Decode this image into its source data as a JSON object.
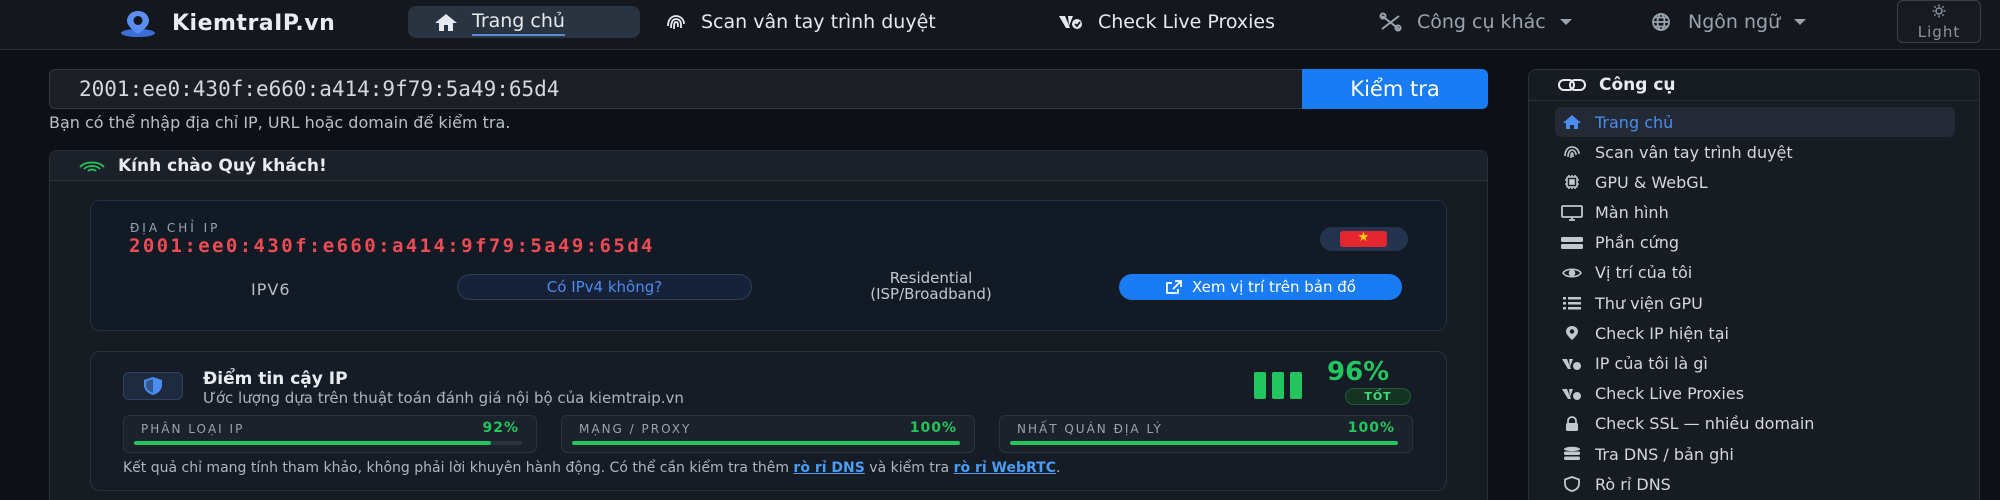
{
  "nav": {
    "brand": "KiemtraIP.vn",
    "items": [
      {
        "label": "Trang chủ",
        "icon": "home-icon",
        "active": true
      },
      {
        "label": "Scan vân tay trình duyệt",
        "icon": "fingerprint-icon"
      },
      {
        "label": "Check Live Proxies",
        "icon": "proxy-icon"
      },
      {
        "label": "Công cụ khác",
        "icon": "tools-icon",
        "dropdown": true
      },
      {
        "label": "Ngôn ngữ",
        "icon": "globe-icon",
        "dropdown": true
      }
    ],
    "theme_label": "Light"
  },
  "search": {
    "value": "2001:ee0:430f:e660:a414:9f79:5a49:65d4",
    "button": "Kiểm tra",
    "hint": "Bạn có thể nhập địa chỉ IP, URL hoặc domain để kiểm tra."
  },
  "welcome": {
    "title": "Kính chào Quý khách!",
    "ip_caption": "ĐỊA CHỈ IP",
    "ip": "2001:ee0:430f:e660:a414:9f79:5a49:65d4",
    "country_flag": "vietnam-flag",
    "ip_version": "IPV6",
    "ipv4_button": "Có IPv4 không?",
    "connection_line1": "Residential",
    "connection_line2": "(ISP/Broadband)",
    "map_button": "Xem vị trí trên bản đồ"
  },
  "trust": {
    "title": "Điểm tin cậy IP",
    "subtitle": "Ước lượng dựa trên thuật toán đánh giá nội bộ của kiemtraip.vn",
    "score": "96%",
    "label": "TỐT",
    "metrics": [
      {
        "label": "PHÂN LOẠI IP",
        "value": "92%",
        "fraction": 0.92
      },
      {
        "label": "MẠNG / PROXY",
        "value": "100%",
        "fraction": 1.0
      },
      {
        "label": "NHẤT QUÁN ĐỊA LÝ",
        "value": "100%",
        "fraction": 1.0
      }
    ],
    "note_prefix": "Kết quả chỉ mang tính tham khảo, không phải lời khuyên hành động. Có thể cần kiểm tra thêm ",
    "note_link1": "rò rỉ DNS",
    "note_mid": " và kiểm tra ",
    "note_link2": "rò rỉ WebRTC",
    "note_suffix": "."
  },
  "sidebar": {
    "title": "Công cụ",
    "items": [
      {
        "label": "Trang chủ",
        "icon": "home-icon",
        "active": true
      },
      {
        "label": "Scan vân tay trình duyệt",
        "icon": "fingerprint-icon"
      },
      {
        "label": "GPU & WebGL",
        "icon": "chip-icon"
      },
      {
        "label": "Màn hình",
        "icon": "monitor-icon"
      },
      {
        "label": "Phần cứng",
        "icon": "server-icon"
      },
      {
        "label": "Vị trí của tôi",
        "icon": "eye-icon"
      },
      {
        "label": "Thư viện GPU",
        "icon": "list-icon"
      },
      {
        "label": "Check IP hiện tại",
        "icon": "location-icon"
      },
      {
        "label": "IP của tôi là gì",
        "icon": "proxy-icon"
      },
      {
        "label": "Check Live Proxies",
        "icon": "proxy-icon"
      },
      {
        "label": "Check SSL — nhiều domain",
        "icon": "lock-icon"
      },
      {
        "label": "Tra DNS / bản ghi",
        "icon": "database-icon"
      },
      {
        "label": "Rò rỉ DNS",
        "icon": "shield-icon"
      }
    ]
  },
  "colors": {
    "accent": "#1a7cf5",
    "ip_red": "#ef4b55",
    "good_green": "#22c55e",
    "background": "#0d1015"
  }
}
